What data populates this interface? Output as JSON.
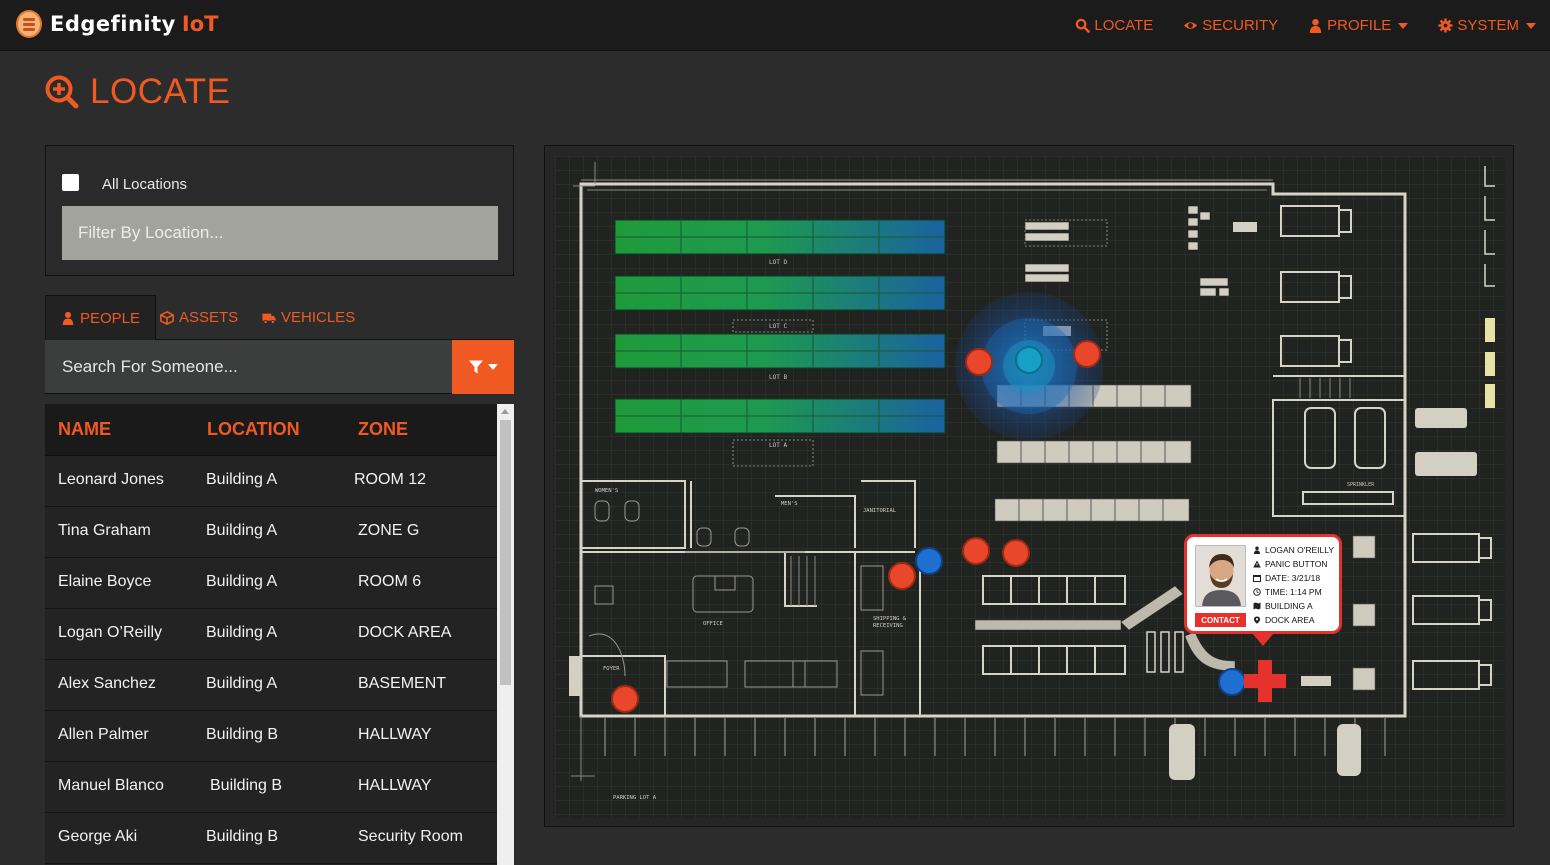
{
  "app": {
    "name": "Edgefinity",
    "suffix": "IoT"
  },
  "nav": {
    "locate": "LOCATE",
    "security": "SECURITY",
    "profile": "PROFILE",
    "system": "SYSTEM"
  },
  "page": {
    "title": "LOCATE"
  },
  "location_filter": {
    "checkbox_label": "All Locations",
    "placeholder": "Filter By Location..."
  },
  "tabs": {
    "people": "PEOPLE",
    "assets": "ASSETS",
    "vehicles": "VEHICLES"
  },
  "search": {
    "placeholder": "Search For Someone..."
  },
  "table": {
    "headers": {
      "name": "NAME",
      "location": "LOCATION",
      "zone": "ZONE"
    },
    "rows": [
      {
        "name": "Leonard Jones",
        "location": "Building A",
        "zone": "ROOM 12"
      },
      {
        "name": "Tina Graham",
        "location": "Building A",
        "zone": "ZONE G"
      },
      {
        "name": "Elaine Boyce",
        "location": "Building A",
        "zone": "ROOM 6"
      },
      {
        "name": "Logan O’Reilly",
        "location": "Building A",
        "zone": "DOCK AREA"
      },
      {
        "name": "Alex Sanchez",
        "location": "Building A",
        "zone": "BASEMENT"
      },
      {
        "name": "Allen Palmer",
        "location": "Building B",
        "zone": "HALLWAY"
      },
      {
        "name": "Manuel Blanco",
        "location": "Building B",
        "zone": "HALLWAY"
      },
      {
        "name": "George Aki",
        "location": "Building B",
        "zone": "Security Room"
      }
    ]
  },
  "map": {
    "labels": {
      "lot_d": "LOT D",
      "lot_c": "LOT C",
      "lot_b": "LOT B",
      "lot_a": "LOT A",
      "womens": "WOMEN'S",
      "mens": "MEN'S",
      "janitorial": "JANITORIAL",
      "office": "OFFICE",
      "shipping_1": "SHIPPING &",
      "shipping_2": "RECEIVING",
      "foyer": "FOYER",
      "parking": "PARKING LOT A",
      "sprinkler": "SPRINKLER"
    }
  },
  "alert": {
    "name": "LOGAN O'REILLY",
    "event": "PANIC BUTTON",
    "date": "DATE: 3/21/18",
    "time": "TIME: 1:14 PM",
    "building": "BUILDING A",
    "zone": "DOCK AREA",
    "contact_label": "CONTACT"
  },
  "colors": {
    "accent": "#f05a22",
    "alert": "#e6322c",
    "person_marker": "#e8472b",
    "asset_marker": "#1f6fd1"
  }
}
